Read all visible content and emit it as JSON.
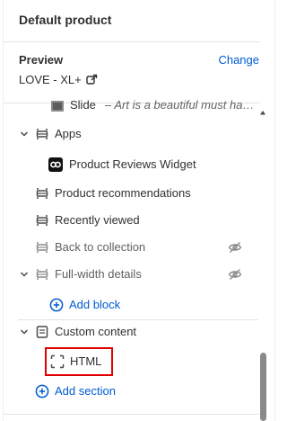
{
  "header": {
    "title": "Default product"
  },
  "preview": {
    "label": "Preview",
    "change": "Change",
    "value": "LOVE - XL+"
  },
  "tree": {
    "slide": {
      "prefix": "Slide",
      "text": "– Art is a beautiful must ha…"
    },
    "apps": "Apps",
    "product_reviews": "Product Reviews Widget",
    "product_recommendations": "Product recommendations",
    "recently_viewed": "Recently viewed",
    "back_to_collection": "Back to collection",
    "full_width_details": "Full-width details",
    "add_block": "Add block",
    "custom_content": "Custom content",
    "html": "HTML",
    "add_section": "Add section"
  },
  "colors": {
    "accent": "#005bd3",
    "highlight": "#e00000",
    "text": "#303030",
    "muted": "#616161"
  }
}
